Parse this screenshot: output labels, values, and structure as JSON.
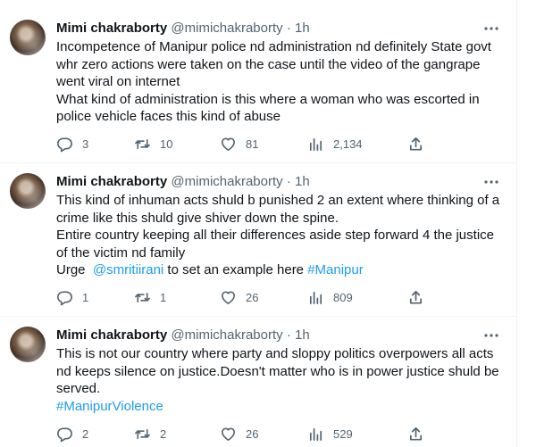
{
  "tweets": [
    {
      "name": "Mimi chakraborty",
      "handle": "@mimichakraborty",
      "dot": "·",
      "time": "1h",
      "lines": [
        "Incompetence of Manipur police nd administration nd definitely State govt",
        "whr zero actions were taken on the case until the video of the gangrape",
        "went viral on internet",
        "What kind of administration is this where a woman who was escorted in",
        "police vehicle faces this kind of abuse"
      ],
      "replies": "3",
      "retweets": "10",
      "likes": "81",
      "views": "2,134"
    },
    {
      "name": "Mimi chakraborty",
      "handle": "@mimichakraborty",
      "dot": "·",
      "time": "1h",
      "lines": [
        "This kind of inhuman acts shuld b punished 2 an extent where thinking of a",
        "crime like this shuld give shiver down the spine.",
        "Entire country keeping all their differences aside step forward 4 the justice",
        "of the victim nd family"
      ],
      "last_line": {
        "prefix": "Urge  ",
        "mention": "@smritiirani",
        "middle": " to set an example here ",
        "hashtag": "#Manipur"
      },
      "replies": "1",
      "retweets": "1",
      "likes": "26",
      "views": "809"
    },
    {
      "name": "Mimi chakraborty",
      "handle": "@mimichakraborty",
      "dot": "·",
      "time": "1h",
      "lines": [
        "This is not our country where party and sloppy politics overpowers all acts",
        "nd keeps silence on justice.Doesn't matter who is in power justice shuld be",
        "served."
      ],
      "hashtag_line": "#ManipurViolence",
      "replies": "2",
      "retweets": "2",
      "likes": "26",
      "views": "529"
    }
  ],
  "icons": {
    "more": "more-dots-icon",
    "reply": "reply-bubble-icon",
    "retweet": "retweet-arrows-icon",
    "like": "heart-icon",
    "views": "views-bar-chart-icon",
    "share": "share-upload-icon"
  },
  "colors": {
    "text": "#0f1419",
    "secondary": "#536471",
    "link": "#1d9bf0",
    "divider": "#eff3f4"
  }
}
